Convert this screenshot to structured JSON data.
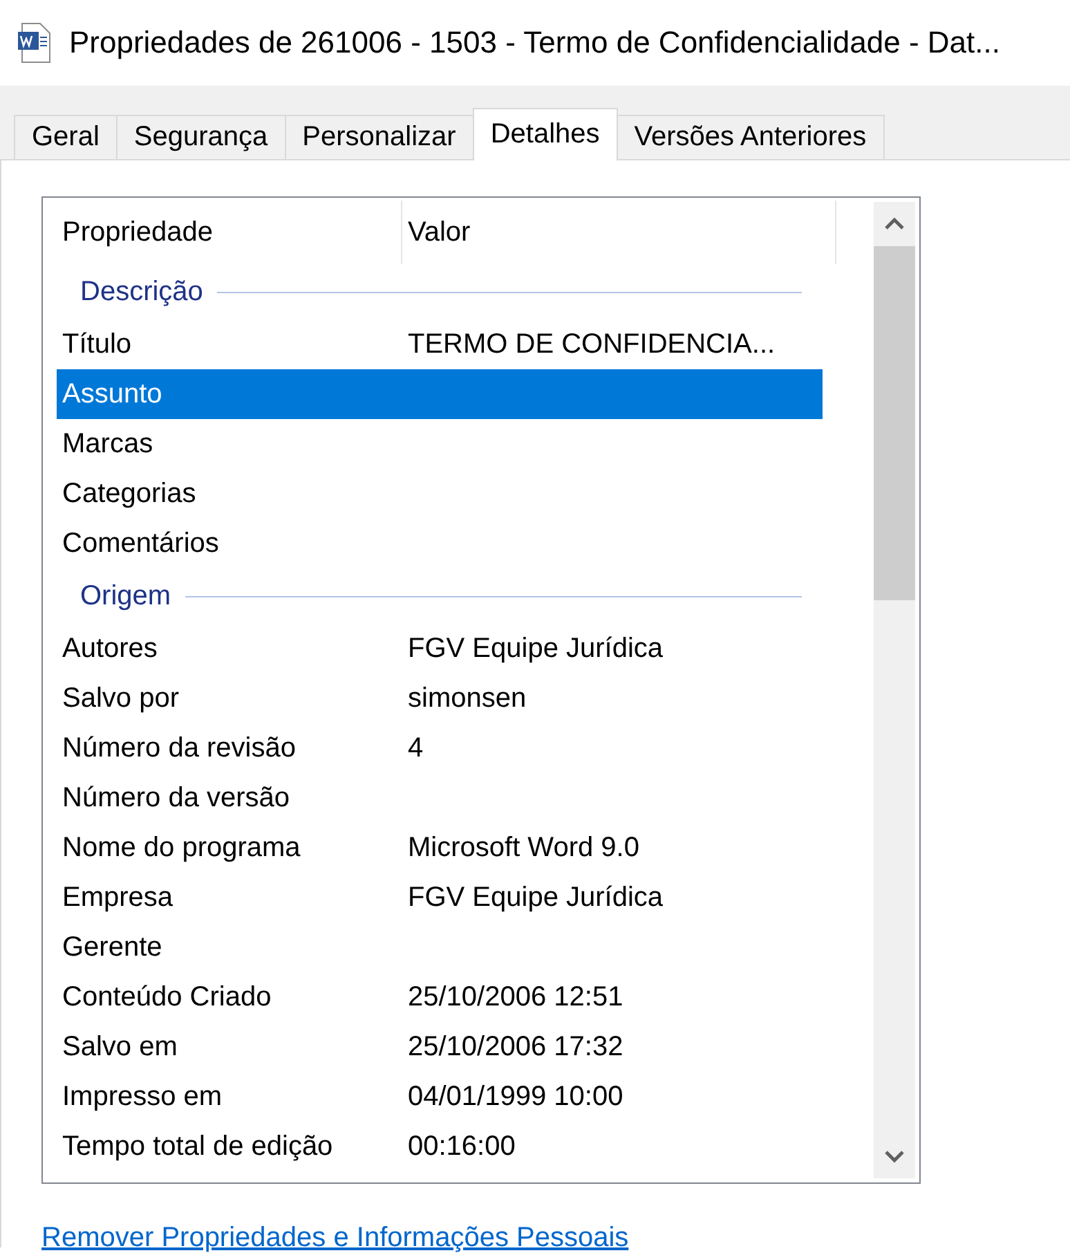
{
  "window": {
    "title": "Propriedades de 261006 - 1503 - Termo de Confidencialidade - Dat..."
  },
  "tabs": [
    {
      "label": "Geral",
      "selected": false
    },
    {
      "label": "Segurança",
      "selected": false
    },
    {
      "label": "Personalizar",
      "selected": false
    },
    {
      "label": "Detalhes",
      "selected": true
    },
    {
      "label": "Versões Anteriores",
      "selected": false
    }
  ],
  "table": {
    "columns": [
      "Propriedade",
      "Valor"
    ],
    "groups": [
      {
        "name": "Descrição",
        "rows": [
          {
            "label": "Título",
            "value": "TERMO DE CONFIDENCIA...",
            "selected": false
          },
          {
            "label": "Assunto",
            "selected": true
          },
          {
            "label": "Marcas",
            "selected": false
          },
          {
            "label": "Categorias",
            "selected": false
          },
          {
            "label": "Comentários",
            "selected": false
          }
        ]
      },
      {
        "name": "Origem",
        "rows": [
          {
            "label": "Autores",
            "value": "FGV Equipe Jurídica",
            "selected": false
          },
          {
            "label": "Salvo por",
            "value": "simonsen",
            "selected": false
          },
          {
            "label": "Número da revisão",
            "value": "4",
            "selected": false
          },
          {
            "label": "Número da versão",
            "selected": false
          },
          {
            "label": "Nome do programa",
            "value": "Microsoft Word 9.0",
            "selected": false
          },
          {
            "label": "Empresa",
            "value": "FGV Equipe Jurídica",
            "selected": false
          },
          {
            "label": "Gerente",
            "selected": false
          },
          {
            "label": "Conteúdo Criado",
            "value": "25/10/2006 12:51",
            "selected": false
          },
          {
            "label": "Salvo em",
            "value": "25/10/2006 17:32",
            "selected": false
          },
          {
            "label": "Impresso em",
            "value": "04/01/1999 10:00",
            "selected": false
          },
          {
            "label": "Tempo total de edição",
            "value": "00:16:00",
            "selected": false
          }
        ]
      }
    ]
  },
  "link": "Remover Propriedades e Informações Pessoais"
}
